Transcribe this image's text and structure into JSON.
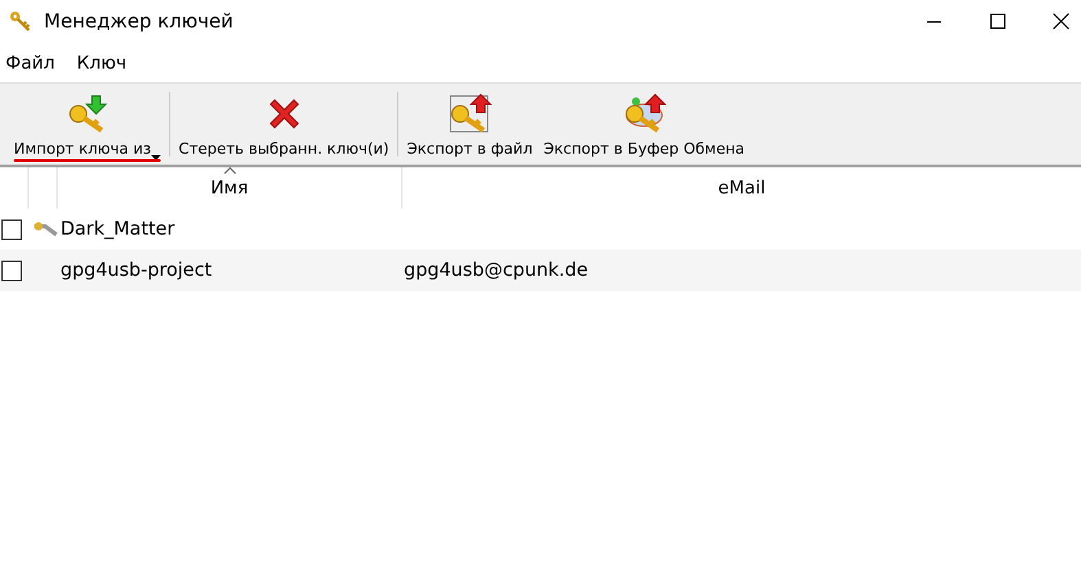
{
  "window": {
    "title": "Менеджер ключей"
  },
  "menu": [
    "Файл",
    "Ключ"
  ],
  "toolbar": [
    {
      "label": "Импорт ключа из",
      "kind": "import",
      "dropdown": true,
      "highlighted": true
    },
    {
      "label": "Стереть выбранн. ключ(и)",
      "kind": "delete",
      "dropdown": false,
      "highlighted": false
    },
    {
      "label": "Экспорт в файл",
      "kind": "export-file",
      "dropdown": false,
      "highlighted": false
    },
    {
      "label": "Экспорт в Буфер Обмена",
      "kind": "export-clipboard",
      "dropdown": false,
      "highlighted": false
    }
  ],
  "table": {
    "columns": [
      "Имя",
      "eMail"
    ],
    "rows": [
      {
        "name": "Dark_Matter",
        "email": "",
        "checked": false,
        "secret": true
      },
      {
        "name": "gpg4usb-project",
        "email": "gpg4usb@cpunk.de",
        "checked": false,
        "secret": false
      }
    ]
  }
}
